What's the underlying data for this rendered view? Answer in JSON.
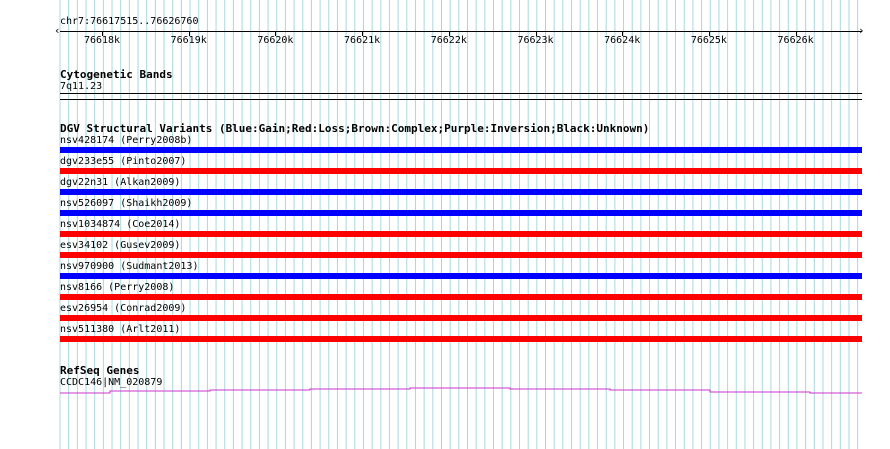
{
  "ruler": {
    "region": "chr7:76617515..76626760",
    "ticks": [
      "76618k",
      "76619k",
      "76620k",
      "76621k",
      "76622k",
      "76623k",
      "76624k",
      "76625k",
      "76626k"
    ]
  },
  "cytobands": {
    "title": "Cytogenetic Bands",
    "band": "7q11.23"
  },
  "dgv": {
    "title": "DGV Structural Variants (Blue:Gain;Red:Loss;Brown:Complex;Purple:Inversion;Black:Unknown)",
    "colors": {
      "gain": "#0000ff",
      "loss": "#ff0000"
    },
    "variants": [
      {
        "label": "nsv428174 (Perry2008b)",
        "type": "gain"
      },
      {
        "label": "dgv233e55 (Pinto2007)",
        "type": "loss"
      },
      {
        "label": "dgv22n31 (Alkan2009)",
        "type": "gain"
      },
      {
        "label": "nsv526097 (Shaikh2009)",
        "type": "gain"
      },
      {
        "label": "nsv1034874 (Coe2014)",
        "type": "loss"
      },
      {
        "label": "esv34102 (Gusev2009)",
        "type": "loss"
      },
      {
        "label": "nsv970900 (Sudmant2013)",
        "type": "gain"
      },
      {
        "label": "nsv8166 (Perry2008)",
        "type": "loss"
      },
      {
        "label": "esv26954 (Conrad2009)",
        "type": "loss"
      },
      {
        "label": "nsv511380 (Arlt2011)",
        "type": "loss"
      }
    ]
  },
  "refseq": {
    "title": "RefSeq Genes",
    "gene": "CCDC146|NM_020879",
    "color": "#cc33cc"
  },
  "grid_color": "#a8d8e0"
}
